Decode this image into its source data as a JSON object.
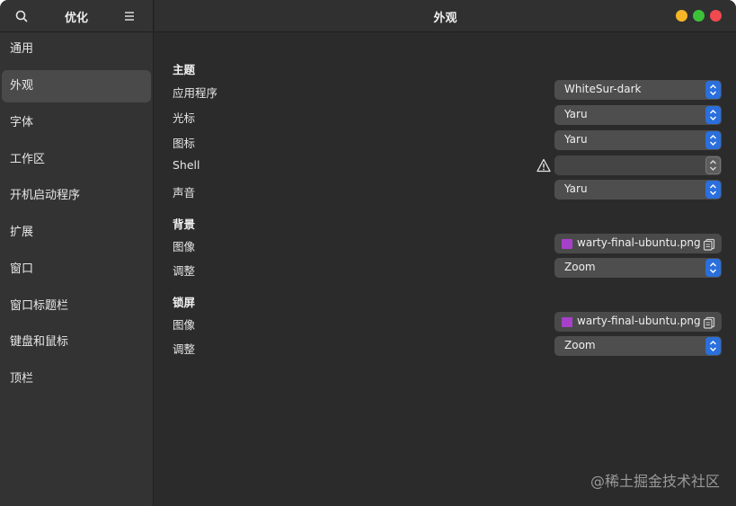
{
  "sidebar": {
    "title": "优化",
    "items": [
      {
        "label": "通用"
      },
      {
        "label": "外观",
        "active": true
      },
      {
        "label": "字体"
      },
      {
        "label": "工作区"
      },
      {
        "label": "开机启动程序"
      },
      {
        "label": "扩展"
      },
      {
        "label": "窗口"
      },
      {
        "label": "窗口标题栏"
      },
      {
        "label": "键盘和鼠标"
      },
      {
        "label": "顶栏"
      }
    ]
  },
  "header": {
    "title": "外观",
    "window_controls": {
      "minimize_color": "#f5b527",
      "maximize_color": "#3cc13b",
      "close_color": "#f04a50"
    }
  },
  "sections": {
    "theme": {
      "title": "主题",
      "rows": [
        {
          "label": "应用程序",
          "value": "WhiteSur-dark"
        },
        {
          "label": "光标",
          "value": "Yaru"
        },
        {
          "label": "图标",
          "value": "Yaru"
        },
        {
          "label": "Shell",
          "value": "",
          "warning": true,
          "disabled": true
        },
        {
          "label": "声音",
          "value": "Yaru"
        }
      ]
    },
    "background": {
      "title": "背景",
      "image_label": "图像",
      "image_file": "warty-final-ubuntu.png",
      "adjust_label": "调整",
      "adjust_value": "Zoom"
    },
    "lockscreen": {
      "title": "锁屏",
      "image_label": "图像",
      "image_file": "warty-final-ubuntu.png",
      "adjust_label": "调整",
      "adjust_value": "Zoom"
    }
  },
  "watermark": "@稀土掘金技术社区",
  "colors": {
    "accent": "#2a6fdc",
    "file_icon": "#a640c9"
  }
}
